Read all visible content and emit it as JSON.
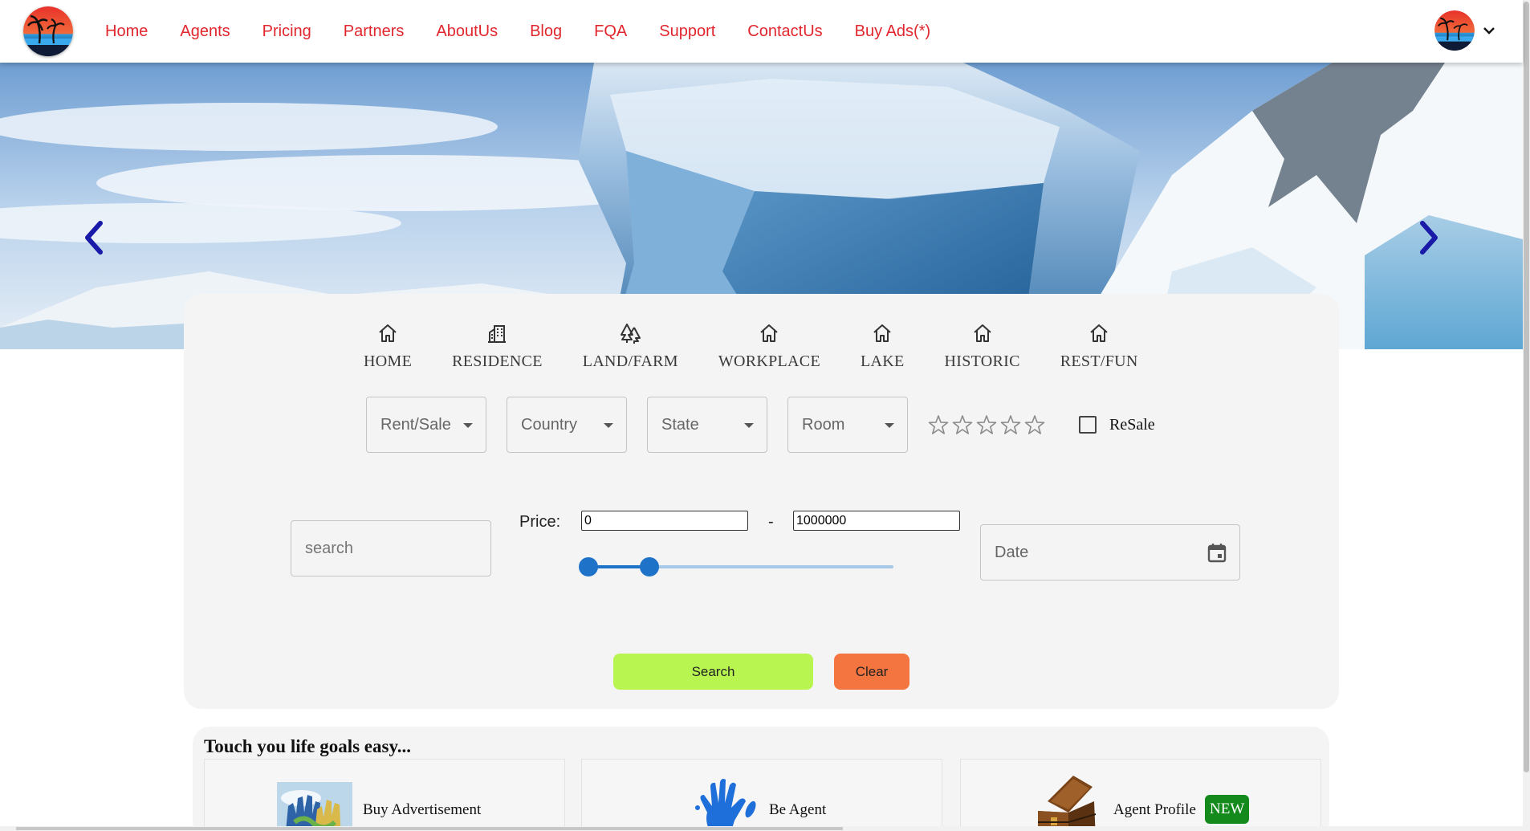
{
  "nav": {
    "logo_icon": "palm-sunset-logo",
    "links": [
      "Home",
      "Agents",
      "Pricing",
      "Partners",
      "AboutUs",
      "Blog",
      "FQA",
      "Support",
      "ContactUs",
      "Buy Ads(*)"
    ],
    "link_color": "#e1262d",
    "user_menu_icon": "chevron-down-icon"
  },
  "hero": {
    "image": "glacier-iceberg-banner",
    "prev_icon": "chevron-left-icon",
    "next_icon": "chevron-right-icon",
    "arrow_color": "#1a1aa8"
  },
  "search": {
    "categories": [
      {
        "label": "HOME",
        "icon": "house-icon"
      },
      {
        "label": "RESIDENCE",
        "icon": "building-icon"
      },
      {
        "label": "LAND/FARM",
        "icon": "trees-icon"
      },
      {
        "label": "WORKPLACE",
        "icon": "house-icon"
      },
      {
        "label": "LAKE",
        "icon": "house-icon"
      },
      {
        "label": "HISTORIC",
        "icon": "house-icon"
      },
      {
        "label": "REST/FUN",
        "icon": "house-icon"
      }
    ],
    "selects": [
      "Rent/Sale",
      "Country",
      "State",
      "Room"
    ],
    "rating": {
      "max": 5,
      "value": 0
    },
    "resale_label": "ReSale",
    "resale_checked": false,
    "search_placeholder": "search",
    "price_label": "Price:",
    "price_min": "0",
    "price_max": "1000000",
    "price_dash": "-",
    "slider": {
      "low_fraction": 0.0,
      "high_fraction": 0.2
    },
    "date_placeholder": "Date",
    "search_button": "Search",
    "clear_button": "Clear",
    "search_button_color": "#b8f551",
    "clear_button_color": "#f4753f"
  },
  "goals": {
    "title": "Touch you life goals easy...",
    "cards": [
      {
        "label": "Buy Advertisement",
        "icon": "hands-globe-image"
      },
      {
        "label": "Be Agent",
        "icon": "blue-handprint-image"
      },
      {
        "label": "Agent Profile",
        "icon": "treasure-chest-image",
        "badge": "NEW"
      }
    ]
  }
}
